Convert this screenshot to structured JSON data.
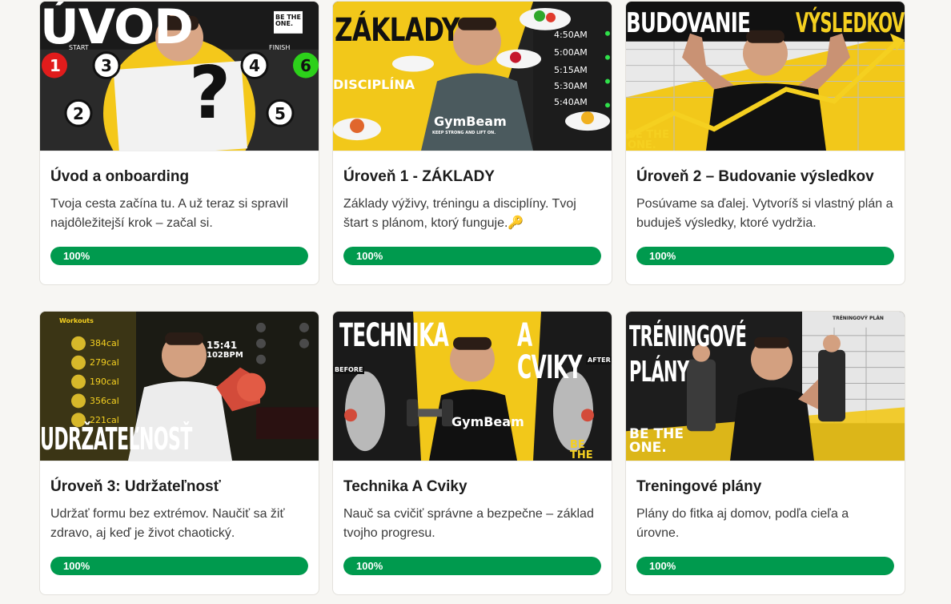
{
  "courses": [
    {
      "title": "Úvod a onboarding",
      "description": "Tvoja cesta začína tu. A už teraz si spravil najdôležitejší krok – začal si.",
      "progress": 100,
      "progress_label": "100%",
      "thumbnail": {
        "headline": "ÚVOD",
        "badge": "BE THE ONE.",
        "numbers": [
          "1",
          "2",
          "3",
          "4",
          "5",
          "6"
        ],
        "start_label": "START",
        "finish_label": "FINISH"
      }
    },
    {
      "title": "Úroveň 1 - ZÁKLADY",
      "description": "Základy výživy, tréningu a disciplíny. Tvoj štart s plánom, ktorý funguje.🔑",
      "progress": 100,
      "progress_label": "100%",
      "thumbnail": {
        "headline": "ZÁKLADY",
        "subline": "DISCIPLÍNA",
        "brand": "GymBeam",
        "brand_tag": "KEEP STRONG AND LIFT ON.",
        "times": [
          "4:50AM",
          "5:00AM",
          "5:15AM",
          "5:30AM",
          "5:40AM"
        ]
      }
    },
    {
      "title": "Úroveň 2 – Budovanie výsledkov",
      "description": "Posúvame sa ďalej. Vytvoríš si vlastný plán a buduješ výsledky, ktoré vydržia.",
      "progress": 100,
      "progress_label": "100%",
      "thumbnail": {
        "headline_left": "BUDOVANIE",
        "headline_right": "VÝSLEDKOV",
        "badge": "BE THE ONE."
      }
    },
    {
      "title": "Úroveň 3: Udržateľnosť",
      "description": "Udržať formu bez extrémov. Naučiť sa žiť zdravo, aj keď je život chaotický.",
      "progress": 100,
      "progress_label": "100%",
      "thumbnail": {
        "headline": "UDRŽATEĽNOSŤ",
        "panel_title": "Workouts",
        "calories": [
          "384cal",
          "279cal",
          "190cal",
          "356cal",
          "221cal"
        ],
        "time": "15:41",
        "bpm": "102BPM"
      }
    },
    {
      "title": "Technika A Cviky",
      "description": "Nauč sa cvičiť správne a bezpečne – základ tvojho progresu.",
      "progress": 100,
      "progress_label": "100%",
      "thumbnail": {
        "headline_left": "TECHNIKA",
        "headline_right": "A CVIKY",
        "before": "BEFORE",
        "after": "AFTER",
        "brand": "GymBeam",
        "badge": "BE THE ONE."
      }
    },
    {
      "title": "Treningové plány",
      "description": "Plány do fitka aj domov, podľa cieľa a úrovne.",
      "progress": 100,
      "progress_label": "100%",
      "thumbnail": {
        "headline_1": "TRÉNINGOVÉ",
        "headline_2": "PLÁNY",
        "badge": "BE THE ONE.",
        "sheet_title": "TRÉNINGOVÝ PLÁN"
      }
    }
  ],
  "colors": {
    "page_bg": "#f7f6f3",
    "card_bg": "#ffffff",
    "progress": "#009a4e",
    "brand_yellow": "#f7d21a"
  }
}
